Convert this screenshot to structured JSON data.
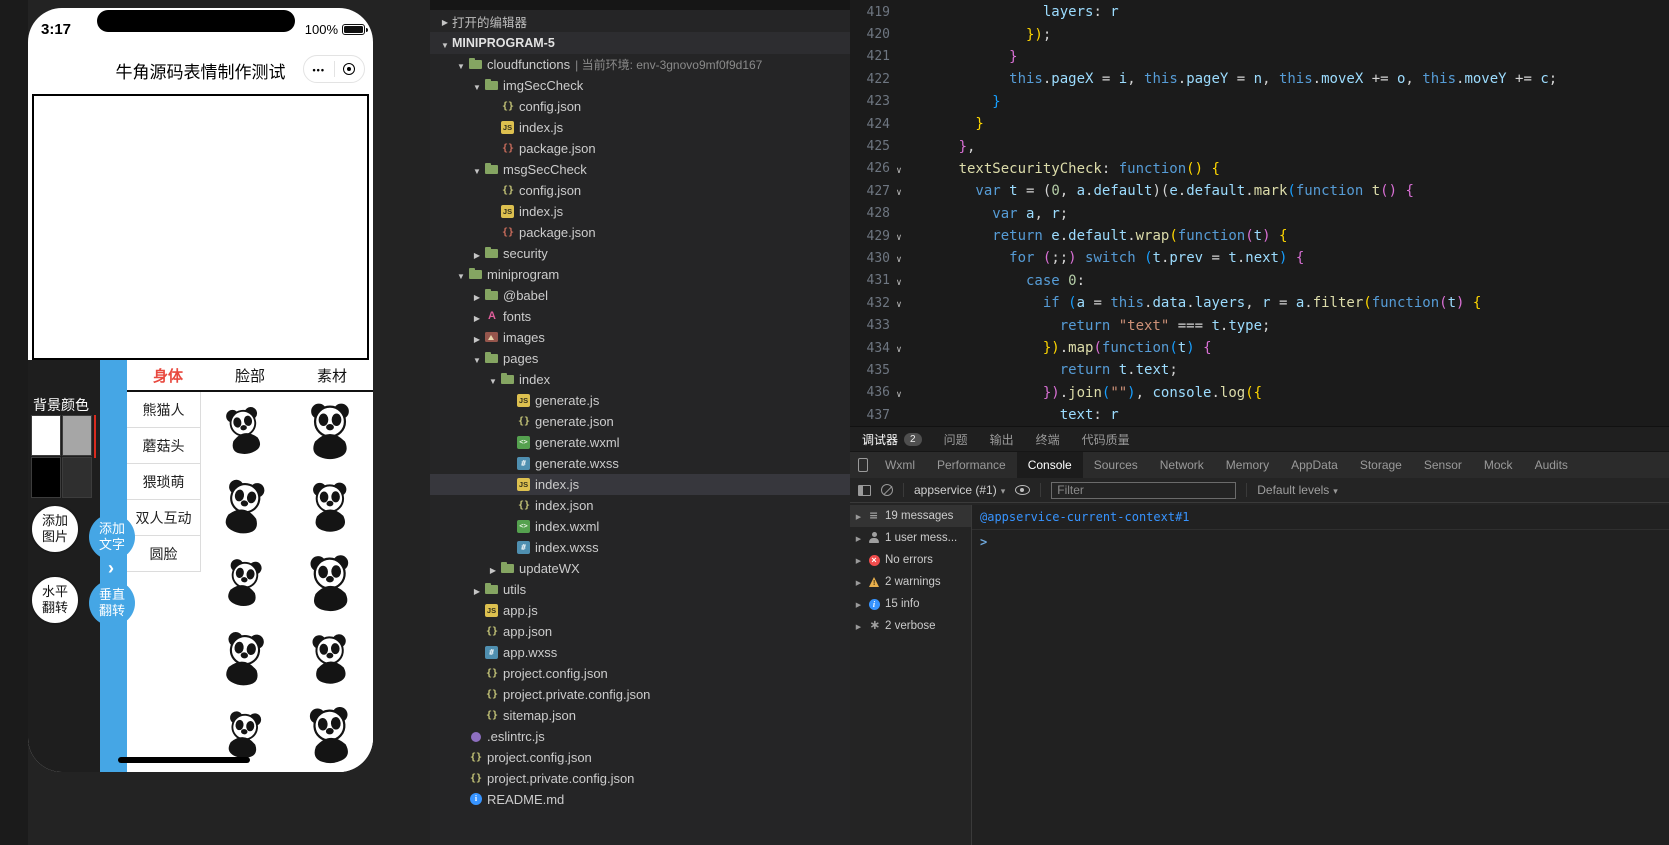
{
  "colors": {
    "accent_blue": "#45a6e5",
    "tab_active_red": "#e8493f",
    "link_blue": "#3794ff",
    "selected_row": "#37373d",
    "error_red": "#f14c4c",
    "warning_yellow": "#e9b04d",
    "info_blue": "#3794ff"
  },
  "simulator": {
    "status": {
      "time": "3:17",
      "battery": "100%"
    },
    "nav": {
      "title": "牛角源码表情制作测试"
    },
    "bg_color_label": "背景颜色",
    "bg_colors": [
      "#ffffff",
      "#a6a6a6",
      "#000000",
      "#2f2f2f"
    ],
    "tabs": [
      {
        "label": "身体",
        "active": true
      },
      {
        "label": "脸部",
        "active": false
      },
      {
        "label": "素材",
        "active": false
      }
    ],
    "categories": [
      {
        "label": "熊猫人",
        "active": true
      },
      {
        "label": "蘑菇头",
        "active": false
      },
      {
        "label": "猥琐萌",
        "active": false
      },
      {
        "label": "双人互动",
        "active": false
      },
      {
        "label": "圆脸",
        "active": false
      }
    ],
    "action_buttons": [
      {
        "id": "add-image",
        "lines": [
          "添加",
          "图片"
        ],
        "variant": "outline"
      },
      {
        "id": "add-text",
        "lines": [
          "添加",
          "文字"
        ],
        "variant": "blue"
      },
      {
        "id": "flip-horizontal",
        "lines": [
          "水平",
          "翻转"
        ],
        "variant": "outline"
      },
      {
        "id": "flip-vertical",
        "lines": [
          "垂直",
          "翻转"
        ],
        "variant": "blue"
      }
    ],
    "sticker_set": "panda",
    "sticker_count": 10
  },
  "explorer": {
    "open_editors": "打开的编辑器",
    "project": "MINIPROGRAM-5",
    "items": [
      {
        "label": "cloudfunctions",
        "note": "| 当前环境: env-3gnovo9mf0f9d167",
        "icon": "folder",
        "level": 1,
        "dir": true,
        "expanded": true
      },
      {
        "label": "imgSecCheck",
        "icon": "folder",
        "level": 2,
        "dir": true,
        "expanded": true
      },
      {
        "label": "config.json",
        "icon": "json",
        "level": 3
      },
      {
        "label": "index.js",
        "icon": "js",
        "level": 3
      },
      {
        "label": "package.json",
        "icon": "npm",
        "level": 3
      },
      {
        "label": "msgSecCheck",
        "icon": "folder",
        "level": 2,
        "dir": true,
        "expanded": true
      },
      {
        "label": "config.json",
        "icon": "json",
        "level": 3
      },
      {
        "label": "index.js",
        "icon": "js",
        "level": 3
      },
      {
        "label": "package.json",
        "icon": "npm",
        "level": 3
      },
      {
        "label": "security",
        "icon": "folder",
        "level": 2,
        "dir": true,
        "expanded": false
      },
      {
        "label": "miniprogram",
        "icon": "folder",
        "level": 1,
        "dir": true,
        "expanded": true
      },
      {
        "label": "@babel",
        "icon": "folder",
        "level": 2,
        "dir": true,
        "expanded": false
      },
      {
        "label": "fonts",
        "icon": "fonts",
        "level": 2,
        "dir": true,
        "expanded": false
      },
      {
        "label": "images",
        "icon": "images",
        "level": 2,
        "dir": true,
        "expanded": false
      },
      {
        "label": "pages",
        "icon": "folder",
        "level": 2,
        "dir": true,
        "expanded": true
      },
      {
        "label": "index",
        "icon": "folder",
        "level": 3,
        "dir": true,
        "expanded": true
      },
      {
        "label": "generate.js",
        "icon": "js",
        "level": 4
      },
      {
        "label": "generate.json",
        "icon": "json",
        "level": 4
      },
      {
        "label": "generate.wxml",
        "icon": "wxml",
        "level": 4
      },
      {
        "label": "generate.wxss",
        "icon": "wxss",
        "level": 4
      },
      {
        "label": "index.js",
        "icon": "js",
        "level": 4,
        "selected": true
      },
      {
        "label": "index.json",
        "icon": "json",
        "level": 4
      },
      {
        "label": "index.wxml",
        "icon": "wxml",
        "level": 4
      },
      {
        "label": "index.wxss",
        "icon": "wxss",
        "level": 4
      },
      {
        "label": "updateWX",
        "icon": "folder",
        "level": 3,
        "dir": true,
        "expanded": false
      },
      {
        "label": "utils",
        "icon": "folder",
        "level": 2,
        "dir": true,
        "expanded": false
      },
      {
        "label": "app.js",
        "icon": "js",
        "level": 2
      },
      {
        "label": "app.json",
        "icon": "json",
        "level": 2
      },
      {
        "label": "app.wxss",
        "icon": "wxss",
        "level": 2
      },
      {
        "label": "project.config.json",
        "icon": "json",
        "level": 2
      },
      {
        "label": "project.private.config.json",
        "icon": "json",
        "level": 2
      },
      {
        "label": "sitemap.json",
        "icon": "json",
        "level": 2
      },
      {
        "label": ".eslintrc.js",
        "icon": "eslint",
        "level": 1
      },
      {
        "label": "project.config.json",
        "icon": "json",
        "level": 1
      },
      {
        "label": "project.private.config.json",
        "icon": "json",
        "level": 1
      },
      {
        "label": "README.md",
        "icon": "md",
        "level": 1
      }
    ]
  },
  "editor": {
    "lines": [
      {
        "n": 419,
        "i": 16,
        "f": false,
        "s": [
          [
            "vr",
            "layers"
          ],
          [
            "pl",
            ": "
          ],
          [
            "vr",
            "r"
          ]
        ]
      },
      {
        "n": 420,
        "i": 14,
        "f": false,
        "s": [
          [
            "b1",
            "})"
          ],
          [
            "pl",
            ";"
          ]
        ]
      },
      {
        "n": 421,
        "i": 12,
        "f": false,
        "s": [
          [
            "b2",
            "}"
          ]
        ]
      },
      {
        "n": 422,
        "i": 12,
        "f": false,
        "s": [
          [
            "kw",
            "this"
          ],
          [
            "pl",
            "."
          ],
          [
            "vr",
            "pageX"
          ],
          [
            "pl",
            " = "
          ],
          [
            "vr",
            "i"
          ],
          [
            "pl",
            ", "
          ],
          [
            "kw",
            "this"
          ],
          [
            "pl",
            "."
          ],
          [
            "vr",
            "pageY"
          ],
          [
            "pl",
            " = "
          ],
          [
            "vr",
            "n"
          ],
          [
            "pl",
            ", "
          ],
          [
            "kw",
            "this"
          ],
          [
            "pl",
            "."
          ],
          [
            "vr",
            "moveX"
          ],
          [
            "pl",
            " += "
          ],
          [
            "vr",
            "o"
          ],
          [
            "pl",
            ", "
          ],
          [
            "kw",
            "this"
          ],
          [
            "pl",
            "."
          ],
          [
            "vr",
            "moveY"
          ],
          [
            "pl",
            " += "
          ],
          [
            "vr",
            "c"
          ],
          [
            "pl",
            ";"
          ]
        ]
      },
      {
        "n": 423,
        "i": 10,
        "f": false,
        "s": [
          [
            "b3",
            "}"
          ]
        ]
      },
      {
        "n": 424,
        "i": 8,
        "f": false,
        "s": [
          [
            "b1",
            "}"
          ]
        ]
      },
      {
        "n": 425,
        "i": 6,
        "f": false,
        "s": [
          [
            "b2",
            "}"
          ],
          [
            "pl",
            ","
          ]
        ]
      },
      {
        "n": 426,
        "i": 6,
        "f": true,
        "s": [
          [
            "fn",
            "textSecurityCheck"
          ],
          [
            "pl",
            ": "
          ],
          [
            "kw",
            "function"
          ],
          [
            "b1",
            "()"
          ],
          [
            "pl",
            " "
          ],
          [
            "b1",
            "{"
          ]
        ]
      },
      {
        "n": 427,
        "i": 8,
        "f": true,
        "s": [
          [
            "kw",
            "var"
          ],
          [
            "pl",
            " "
          ],
          [
            "vr",
            "t"
          ],
          [
            "pl",
            " = ("
          ],
          [
            "nu",
            "0"
          ],
          [
            "pl",
            ", "
          ],
          [
            "vr",
            "a"
          ],
          [
            "pl",
            "."
          ],
          [
            "vr",
            "default"
          ],
          [
            "pl",
            ")("
          ],
          [
            "vr",
            "e"
          ],
          [
            "pl",
            "."
          ],
          [
            "vr",
            "default"
          ],
          [
            "pl",
            "."
          ],
          [
            "fn",
            "mark"
          ],
          [
            "b3",
            "("
          ],
          [
            "kw",
            "function"
          ],
          [
            "pl",
            " "
          ],
          [
            "fn",
            "t"
          ],
          [
            "b2",
            "()"
          ],
          [
            "pl",
            " "
          ],
          [
            "b2",
            "{"
          ]
        ]
      },
      {
        "n": 428,
        "i": 10,
        "f": false,
        "s": [
          [
            "kw",
            "var"
          ],
          [
            "pl",
            " "
          ],
          [
            "vr",
            "a"
          ],
          [
            "pl",
            ", "
          ],
          [
            "vr",
            "r"
          ],
          [
            "pl",
            ";"
          ]
        ]
      },
      {
        "n": 429,
        "i": 10,
        "f": true,
        "s": [
          [
            "kw",
            "return"
          ],
          [
            "pl",
            " "
          ],
          [
            "vr",
            "e"
          ],
          [
            "pl",
            "."
          ],
          [
            "vr",
            "default"
          ],
          [
            "pl",
            "."
          ],
          [
            "fn",
            "wrap"
          ],
          [
            "b1",
            "("
          ],
          [
            "kw",
            "function"
          ],
          [
            "b2",
            "("
          ],
          [
            "vr",
            "t"
          ],
          [
            "b2",
            ")"
          ],
          [
            "pl",
            " "
          ],
          [
            "b1",
            "{"
          ]
        ]
      },
      {
        "n": 430,
        "i": 12,
        "f": true,
        "s": [
          [
            "kw",
            "for"
          ],
          [
            "pl",
            " "
          ],
          [
            "b2",
            "("
          ],
          [
            "pl",
            ";;"
          ],
          [
            "b2",
            ")"
          ],
          [
            "pl",
            " "
          ],
          [
            "kw",
            "switch"
          ],
          [
            "pl",
            " "
          ],
          [
            "b3",
            "("
          ],
          [
            "vr",
            "t"
          ],
          [
            "pl",
            "."
          ],
          [
            "vr",
            "prev"
          ],
          [
            "pl",
            " = "
          ],
          [
            "vr",
            "t"
          ],
          [
            "pl",
            "."
          ],
          [
            "vr",
            "next"
          ],
          [
            "b3",
            ")"
          ],
          [
            "pl",
            " "
          ],
          [
            "b2",
            "{"
          ]
        ]
      },
      {
        "n": 431,
        "i": 14,
        "f": true,
        "s": [
          [
            "kw",
            "case"
          ],
          [
            "pl",
            " "
          ],
          [
            "nu",
            "0"
          ],
          [
            "pl",
            ":"
          ]
        ]
      },
      {
        "n": 432,
        "i": 16,
        "f": true,
        "s": [
          [
            "kw",
            "if"
          ],
          [
            "pl",
            " "
          ],
          [
            "b3",
            "("
          ],
          [
            "vr",
            "a"
          ],
          [
            "pl",
            " = "
          ],
          [
            "kw",
            "this"
          ],
          [
            "pl",
            "."
          ],
          [
            "vr",
            "data"
          ],
          [
            "pl",
            "."
          ],
          [
            "vr",
            "layers"
          ],
          [
            "pl",
            ", "
          ],
          [
            "vr",
            "r"
          ],
          [
            "pl",
            " = "
          ],
          [
            "vr",
            "a"
          ],
          [
            "pl",
            "."
          ],
          [
            "fn",
            "filter"
          ],
          [
            "b1",
            "("
          ],
          [
            "kw",
            "function"
          ],
          [
            "b2",
            "("
          ],
          [
            "vr",
            "t"
          ],
          [
            "b2",
            ")"
          ],
          [
            "pl",
            " "
          ],
          [
            "b1",
            "{"
          ]
        ]
      },
      {
        "n": 433,
        "i": 18,
        "f": false,
        "s": [
          [
            "kw",
            "return"
          ],
          [
            "pl",
            " "
          ],
          [
            "st",
            "\"text\""
          ],
          [
            "pl",
            " === "
          ],
          [
            "vr",
            "t"
          ],
          [
            "pl",
            "."
          ],
          [
            "vr",
            "type"
          ],
          [
            "pl",
            ";"
          ]
        ]
      },
      {
        "n": 434,
        "i": 16,
        "f": true,
        "s": [
          [
            "b1",
            "})"
          ],
          [
            "pl",
            "."
          ],
          [
            "fn",
            "map"
          ],
          [
            "b2",
            "("
          ],
          [
            "kw",
            "function"
          ],
          [
            "b3",
            "("
          ],
          [
            "vr",
            "t"
          ],
          [
            "b3",
            ")"
          ],
          [
            "pl",
            " "
          ],
          [
            "b2",
            "{"
          ]
        ]
      },
      {
        "n": 435,
        "i": 18,
        "f": false,
        "s": [
          [
            "kw",
            "return"
          ],
          [
            "pl",
            " "
          ],
          [
            "vr",
            "t"
          ],
          [
            "pl",
            "."
          ],
          [
            "vr",
            "text"
          ],
          [
            "pl",
            ";"
          ]
        ]
      },
      {
        "n": 436,
        "i": 16,
        "f": true,
        "s": [
          [
            "b2",
            "})"
          ],
          [
            "pl",
            "."
          ],
          [
            "fn",
            "join"
          ],
          [
            "b3",
            "("
          ],
          [
            "st",
            "\"\""
          ],
          [
            "b3",
            ")"
          ],
          [
            "pl",
            ", "
          ],
          [
            "vr",
            "console"
          ],
          [
            "pl",
            "."
          ],
          [
            "fn",
            "log"
          ],
          [
            "b1",
            "({"
          ]
        ]
      },
      {
        "n": 437,
        "i": 18,
        "f": false,
        "s": [
          [
            "vr",
            "text"
          ],
          [
            "pl",
            ": "
          ],
          [
            "vr",
            "r"
          ]
        ]
      }
    ]
  },
  "debugger": {
    "panel_tabs": [
      {
        "label": "调试器",
        "badge": "2",
        "active": true
      },
      {
        "label": "问题",
        "active": false
      },
      {
        "label": "输出",
        "active": false
      },
      {
        "label": "终端",
        "active": false
      },
      {
        "label": "代码质量",
        "active": false
      }
    ],
    "tool_tabs": [
      {
        "label": "Wxml",
        "active": false
      },
      {
        "label": "Performance",
        "active": false
      },
      {
        "label": "Console",
        "active": true
      },
      {
        "label": "Sources",
        "active": false
      },
      {
        "label": "Network",
        "active": false
      },
      {
        "label": "Memory",
        "active": false
      },
      {
        "label": "AppData",
        "active": false
      },
      {
        "label": "Storage",
        "active": false
      },
      {
        "label": "Sensor",
        "active": false
      },
      {
        "label": "Mock",
        "active": false
      },
      {
        "label": "Audits",
        "active": false
      }
    ],
    "toolbar": {
      "context": "appservice (#1)",
      "filter_placeholder": "Filter",
      "levels": "Default levels"
    },
    "sidebar": [
      {
        "icon": "list",
        "label": "19 messages",
        "selected": true
      },
      {
        "icon": "user",
        "label": "1 user mess...",
        "selected": false
      },
      {
        "icon": "error",
        "label": "No errors",
        "selected": false
      },
      {
        "icon": "warning",
        "label": "2 warnings",
        "selected": false
      },
      {
        "icon": "info",
        "label": "15 info",
        "selected": false
      },
      {
        "icon": "verbose",
        "label": "2 verbose",
        "selected": false
      }
    ],
    "console": {
      "context_line": "@appservice-current-context#1",
      "prompt": ">"
    }
  }
}
